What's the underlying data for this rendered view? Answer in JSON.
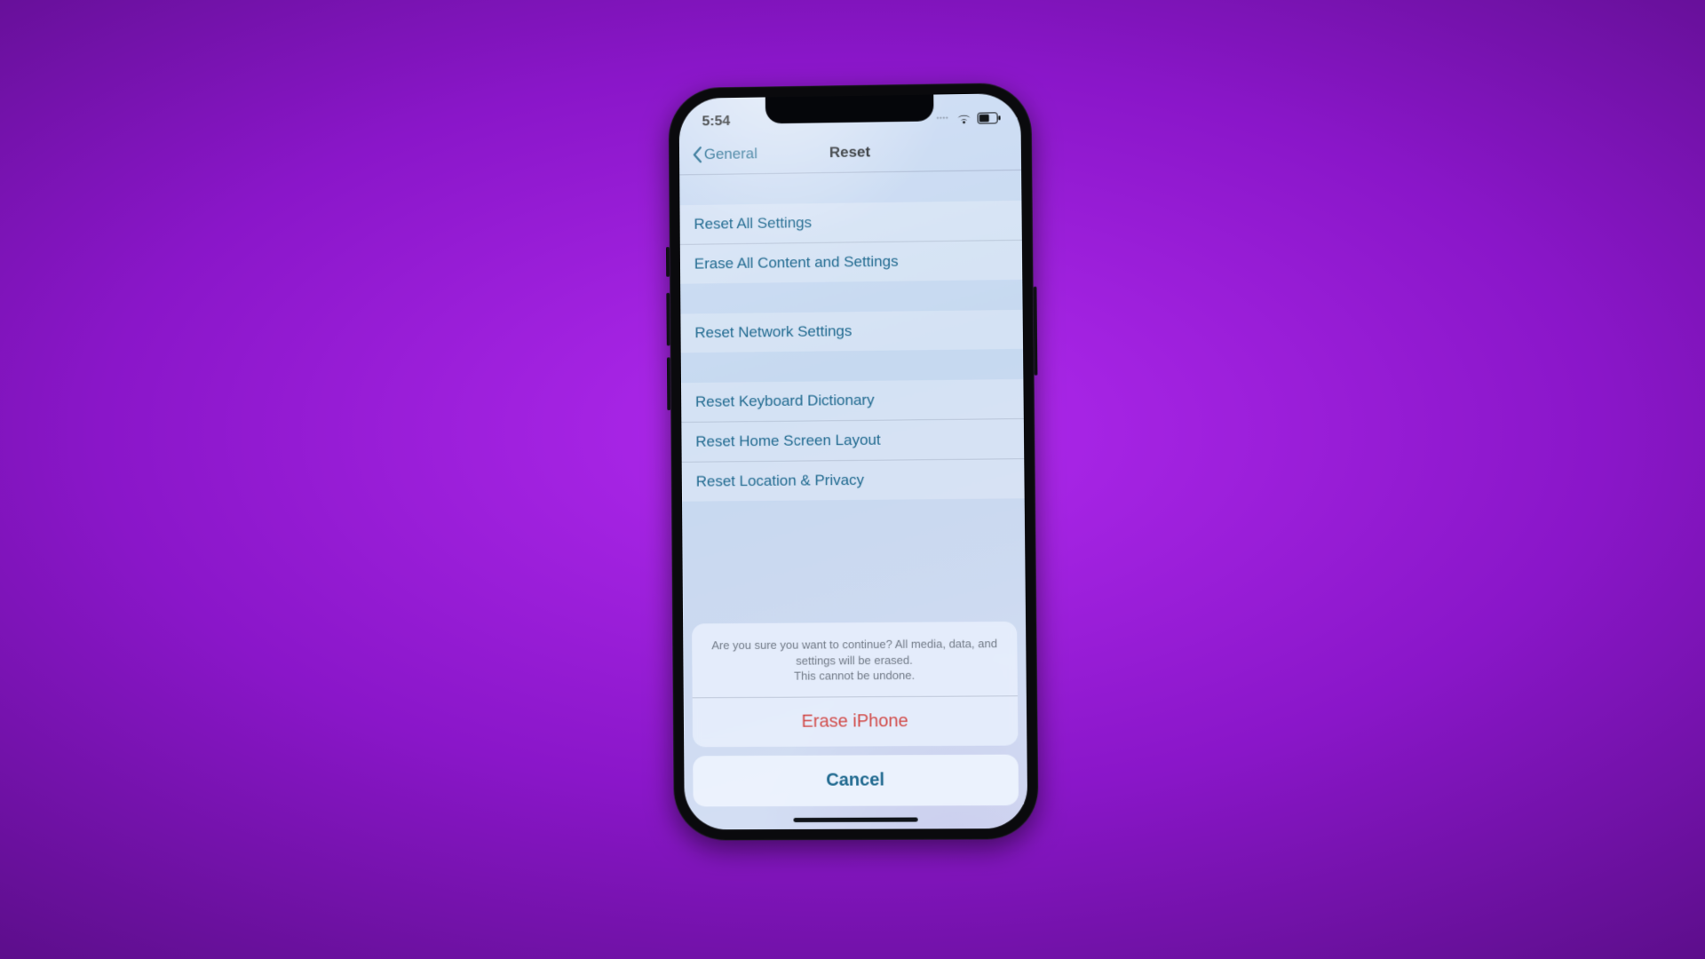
{
  "status": {
    "time": "5:54"
  },
  "nav": {
    "back_label": "General",
    "title": "Reset"
  },
  "groups": [
    {
      "items": [
        "Reset All Settings",
        "Erase All Content and Settings"
      ]
    },
    {
      "items": [
        "Reset Network Settings"
      ]
    },
    {
      "items": [
        "Reset Keyboard Dictionary",
        "Reset Home Screen Layout",
        "Reset Location & Privacy"
      ]
    }
  ],
  "sheet": {
    "message_line1": "Are you sure you want to continue? All media, data, and settings will be erased.",
    "message_line2": "This cannot be undone.",
    "destructive_label": "Erase iPhone",
    "cancel_label": "Cancel"
  },
  "colors": {
    "link": "#1f698f",
    "destructive": "#d14b49",
    "bg_gradient_center": "#b22af0",
    "bg_gradient_edge": "#5d0e8c"
  }
}
